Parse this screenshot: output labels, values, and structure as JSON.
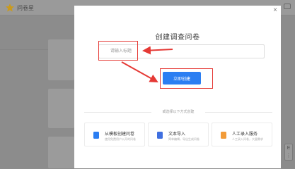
{
  "app": {
    "name": "问卷星"
  },
  "header": {
    "right_icon": "window-icon"
  },
  "modal": {
    "title": "创建调查问卷",
    "close_label": "×",
    "input": {
      "placeholder": "请输入标题",
      "value": ""
    },
    "create_button": "立即创建",
    "or_text": "或选择以下方式创建"
  },
  "options": [
    {
      "title": "从模板创建问卷",
      "desc": "使用免费用户公开的问卷",
      "icon": "document-icon",
      "color": "#2b7ef2"
    },
    {
      "title": "文本导入",
      "desc": "简单编辑，导出生成问卷",
      "icon": "text-import-icon",
      "color": "#3f6fe0"
    },
    {
      "title": "人工录入服务",
      "desc": "人工录入问卷，大量需求",
      "icon": "service-icon",
      "color": "#f29b38"
    }
  ],
  "side_tools": [
    "E",
    "⋮"
  ],
  "colors": {
    "accent": "#2b7ef2",
    "highlight": "#e53935",
    "overlay": "#8d8d8d"
  }
}
